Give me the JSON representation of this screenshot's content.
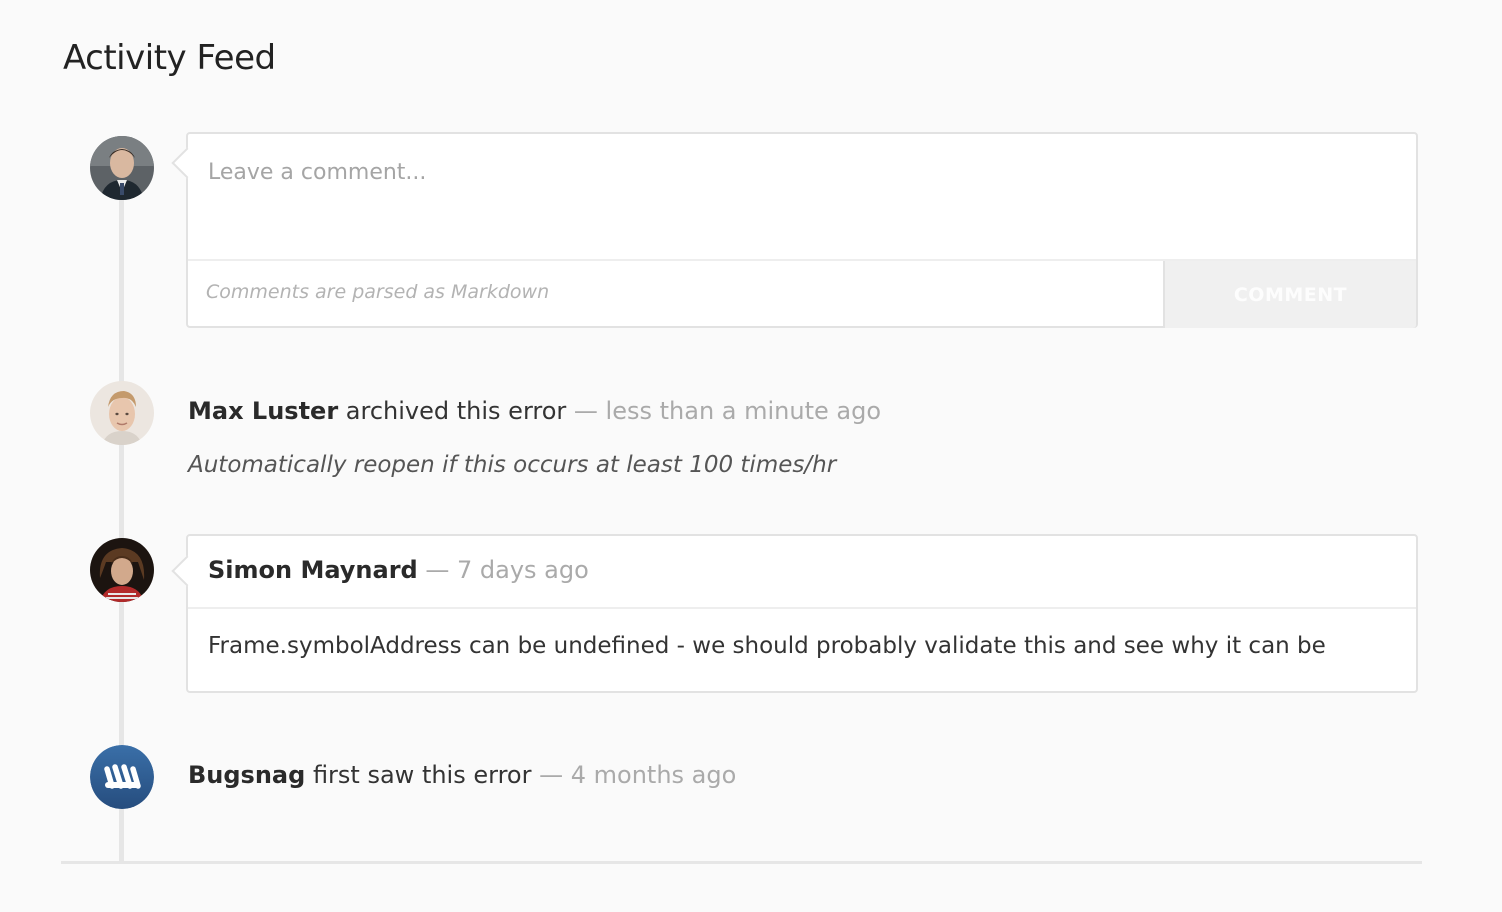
{
  "header": {
    "title": "Activity Feed"
  },
  "comment_form": {
    "placeholder": "Leave a comment...",
    "value": "",
    "markdown_hint": "Comments are parsed as Markdown",
    "submit_label": "COMMENT"
  },
  "events": [
    {
      "author": "Max Luster",
      "action": " archived this error",
      "separator": " — ",
      "time": "less than a minute ago",
      "note": "Automatically reopen if this occurs at least 100 times/hr"
    },
    {
      "author": "Simon Maynard",
      "separator": " — ",
      "time": "7 days ago",
      "body": "Frame.symbolAddress can be undefined - we should probably validate this and see why it can be"
    },
    {
      "author": "Bugsnag",
      "action": " first saw this error",
      "separator": " — ",
      "time": "4 months ago"
    }
  ],
  "colors": {
    "background": "#fafafa",
    "timeline": "#e6e6e6",
    "muted_text": "#aaaaaa",
    "bugsnag_avatar": "#2f5f95"
  },
  "icons": {
    "current_user": "user-avatar",
    "max_luster": "user-avatar",
    "simon_maynard": "user-avatar",
    "bugsnag": "bugsnag-logo-icon"
  }
}
